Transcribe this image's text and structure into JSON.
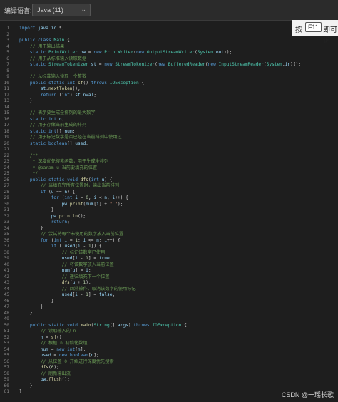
{
  "toolbar": {
    "lang_label": "编译语言:",
    "lang_value": "Java (11)",
    "chevron": "chevron-down-icon"
  },
  "hint": {
    "press": "按",
    "key": "F11",
    "tail": "即可退"
  },
  "code_lines": [
    "import java.io.*;",
    "",
    "public class Main {",
    "    // 用于输出结果",
    "    static PrintWriter pw = new PrintWriter(new OutputStreamWriter(System.out));",
    "    // 用于从标准输入读取数据",
    "    static StreamTokenizer st = new StreamTokenizer(new BufferedReader(new InputStreamReader(System.in)));",
    "",
    "    // 从标准输入读取一个整数",
    "    public static int sf() throws IOException {",
    "        st.nextToken();",
    "        return (int) st.nval;",
    "    }",
    "",
    "    // 表示要生成全排列的最大数字",
    "    static int n;",
    "    // 用于存储当前生成的排列",
    "    static int[] num;",
    "    // 用于标记数字是否已经在当前排列中使用过",
    "    static boolean[] used;",
    "",
    "    /**",
    "     * 深度优先搜索函数，用于生成全排列",
    "     * @param u 当前要填充的位置",
    "     */",
    "    public static void dfs(int u) {",
    "        // 当填充完所有位置时，输出当前排列",
    "        if (u == n) {",
    "            for (int i = 0; i < n; i++) {",
    "                pw.print(num[i] + \" \");",
    "            }",
    "            pw.println();",
    "            return;",
    "        }",
    "        // 尝试将每个未使用的数字放入当前位置",
    "        for (int i = 1; i <= n; i++) {",
    "            if (!used[i - 1]) {",
    "                // 标记该数字已使用",
    "                used[i - 1] = true;",
    "                // 将该数字放入当前位置",
    "                num[u] = i;",
    "                // 递归填充下一个位置",
    "                dfs(u + 1);",
    "                // 回溯操作，取消该数字的使用标记",
    "                used[i - 1] = false;",
    "            }",
    "        }",
    "    }",
    "",
    "    public static void main(String[] args) throws IOException {",
    "        // 读取输入的 n",
    "        n = sf();",
    "        // 根据 n 初始化数组",
    "        num = new int[n];",
    "        used = new boolean[n];",
    "        // 从位置 0 开始进行深度优先搜索",
    "        dfs(0);",
    "        // 刷新输出流",
    "        pw.flush();",
    "    }",
    "}"
  ],
  "colors": {
    "keyword": "#569cd6",
    "type": "#4ec9b0",
    "comment": "#6a9955",
    "string": "#ce9178",
    "number": "#b5cea8",
    "method": "#dcdcaa",
    "text": "#d4d4d4"
  },
  "watermark": "CSDN @一瑶长歌"
}
